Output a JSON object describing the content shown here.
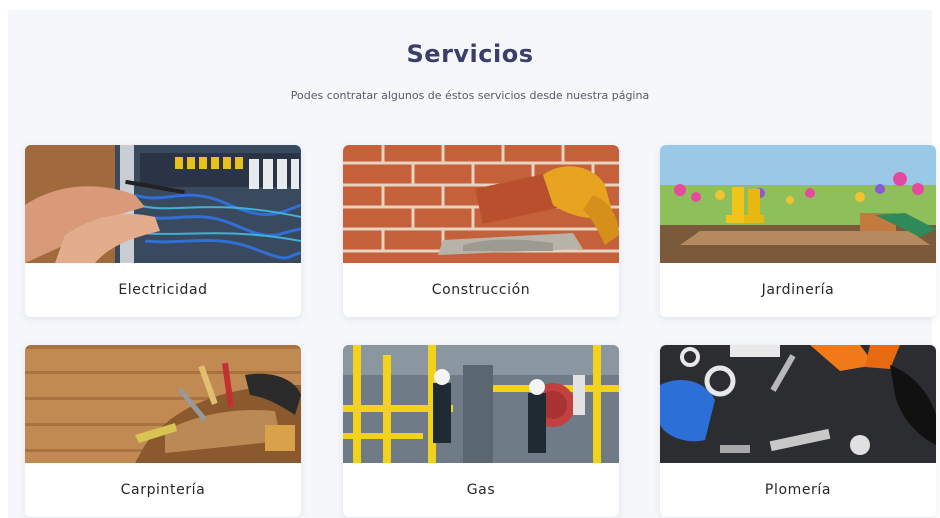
{
  "section": {
    "title": "Servicios",
    "subtitle": "Podes contratar algunos de éstos servicios desde nuestra página"
  },
  "services": [
    {
      "label": "Electricidad",
      "icon": "electrical-panel-image"
    },
    {
      "label": "Construcción",
      "icon": "bricklaying-image"
    },
    {
      "label": "Jardinería",
      "icon": "garden-image"
    },
    {
      "label": "Carpintería",
      "icon": "tool-belt-image"
    },
    {
      "label": "Gas",
      "icon": "gas-plant-image"
    },
    {
      "label": "Plomería",
      "icon": "plumbing-tools-image"
    }
  ],
  "colors": {
    "title": "#3b3d6b",
    "background": "#f5f7fb",
    "card": "#ffffff"
  }
}
